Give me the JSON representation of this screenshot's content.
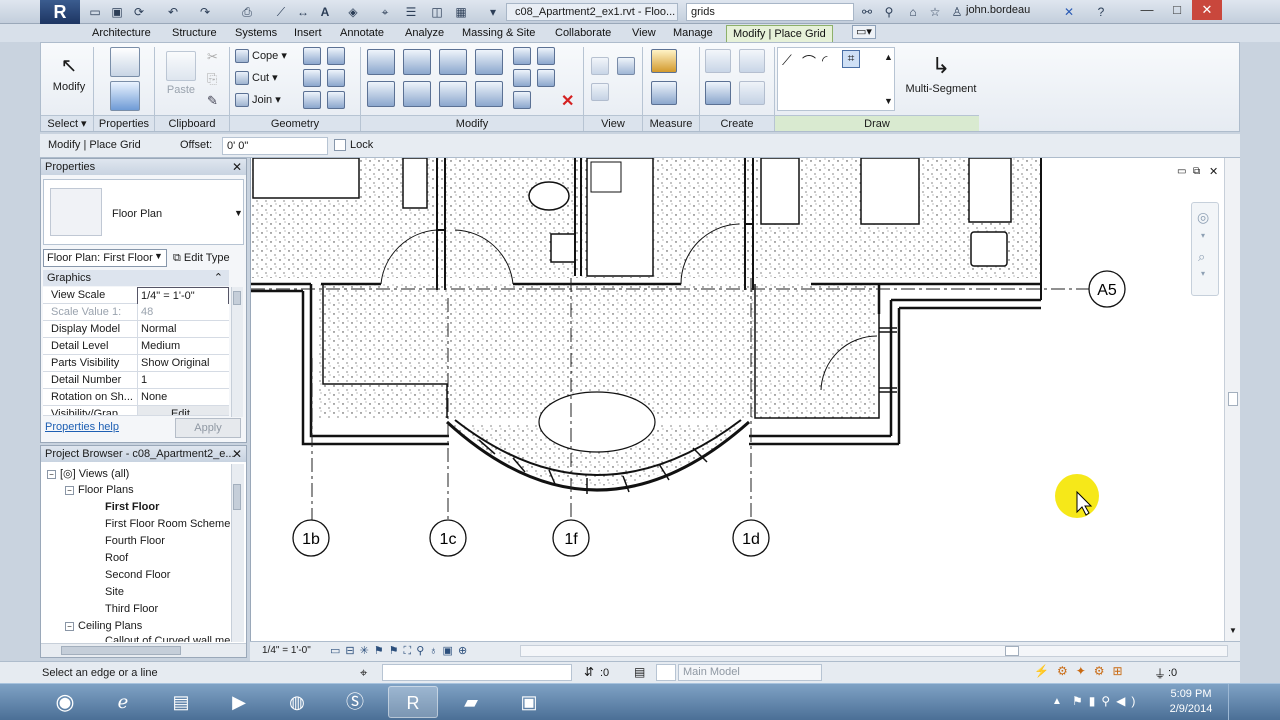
{
  "titlebar": {
    "app_logo": "R",
    "file_title": "c08_Apartment2_ex1.rvt - Floo...",
    "search_value": "grids",
    "user": "john.bordeau"
  },
  "tabs": [
    "Architecture",
    "Structure",
    "Systems",
    "Insert",
    "Annotate",
    "Analyze",
    "Massing & Site",
    "Collaborate",
    "View",
    "Manage",
    "Modify | Place Grid"
  ],
  "ribbon": {
    "modify_label": "Modify",
    "properties_label": "Properties",
    "paste_label": "Paste",
    "cope_label": "Cope",
    "cut_label": "Cut",
    "join_label": "Join",
    "multi_segment_label": "Multi-Segment",
    "panels": {
      "select": "Select",
      "properties": "Properties",
      "clipboard": "Clipboard",
      "geometry": "Geometry",
      "modify": "Modify",
      "view": "View",
      "measure": "Measure",
      "create": "Create",
      "draw": "Draw"
    }
  },
  "optionsbar": {
    "context": "Modify | Place Grid",
    "offset_label": "Offset:",
    "offset_value": "0'  0\"",
    "lock_label": "Lock"
  },
  "properties": {
    "title": "Properties",
    "type_name": "Floor Plan",
    "instance_selector": "Floor Plan: First Floor",
    "edit_type": "Edit Type",
    "section": "Graphics",
    "rows": [
      {
        "name": "View Scale",
        "value": "1/4\" = 1'-0\""
      },
      {
        "name": "Scale Value    1:",
        "value": "48"
      },
      {
        "name": "Display Model",
        "value": "Normal"
      },
      {
        "name": "Detail Level",
        "value": "Medium"
      },
      {
        "name": "Parts Visibility",
        "value": "Show Original"
      },
      {
        "name": "Detail Number",
        "value": "1"
      },
      {
        "name": "Rotation on Sh...",
        "value": "None"
      },
      {
        "name": "Visibility/Grap...",
        "value": "Edit..."
      }
    ],
    "help_link": "Properties help",
    "apply": "Apply"
  },
  "browser": {
    "title": "Project Browser - c08_Apartment2_e...",
    "views_root": "Views (all)",
    "floor_plans": "Floor Plans",
    "plans": [
      "First Floor",
      "First Floor Room Scheme",
      "Fourth Floor",
      "Roof",
      "Second Floor",
      "Site",
      "Third Floor"
    ],
    "ceiling_plans": "Ceiling Plans",
    "ceiling_item": "Callout of Curved wall me"
  },
  "canvas": {
    "grid_bubbles": [
      "1b",
      "1c",
      "1f",
      "1d",
      "A5"
    ]
  },
  "viewbar": {
    "scale": "1/4\" = 1'-0\""
  },
  "statusbar": {
    "message": "Select an edge or a line",
    "worksets_count": ":0",
    "design_option": "Main Model",
    "filter_count": ":0"
  },
  "taskbar": {
    "time": "5:09 PM",
    "date": "2/9/2014"
  }
}
